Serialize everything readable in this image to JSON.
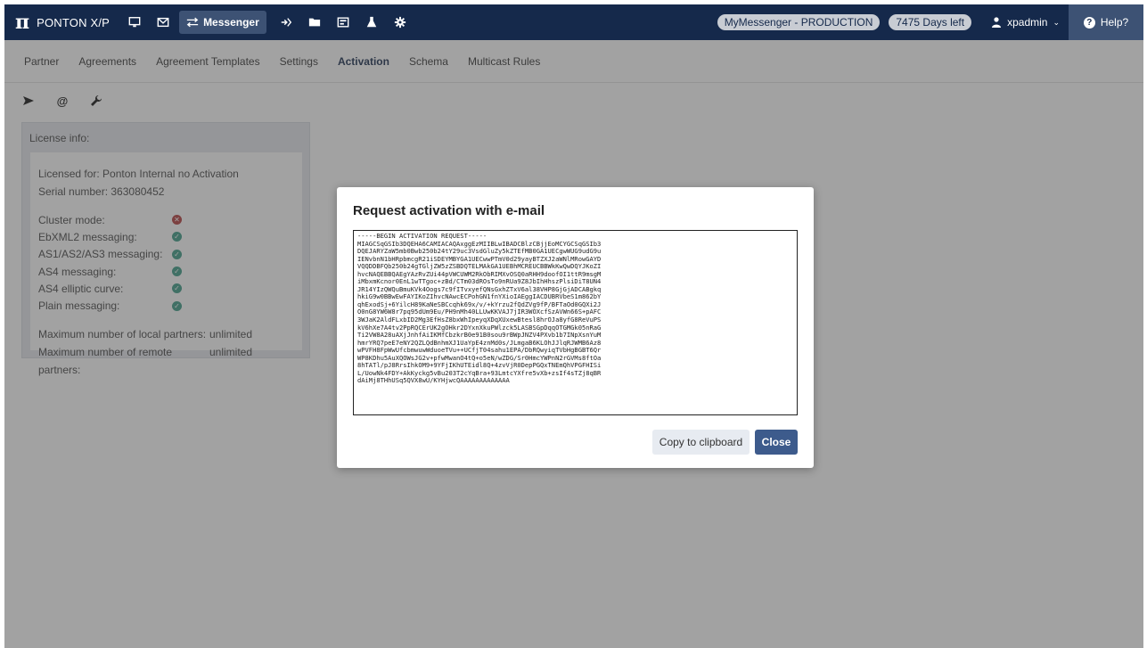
{
  "app": {
    "logo_glyph": "π",
    "name": "PONTON X/P"
  },
  "topnav": {
    "icons": [
      "monitor-icon",
      "mail-icon",
      "route-icon",
      "folder-icon",
      "card-icon",
      "flask-icon",
      "gear-icon"
    ],
    "active_label": "Messenger",
    "environment": "MyMessenger - PRODUCTION",
    "license_days": "7475 Days left",
    "user": "xpadmin",
    "help": "Help?"
  },
  "subnav": {
    "tabs": [
      "Partner",
      "Agreements",
      "Agreement Templates",
      "Settings",
      "Activation",
      "Schema",
      "Multicast Rules"
    ],
    "active": "Activation"
  },
  "toolbar": {
    "at_glyph": "@"
  },
  "license": {
    "heading": "License info:",
    "licensed_for": "Licensed for: Ponton Internal no Activation",
    "serial": "Serial number: 363080452",
    "features": [
      {
        "label": "Cluster mode:",
        "status": "no"
      },
      {
        "label": "EbXML2 messaging:",
        "status": "ok"
      },
      {
        "label": "AS1/AS2/AS3 messaging:",
        "status": "ok"
      },
      {
        "label": "AS4 messaging:",
        "status": "ok"
      },
      {
        "label": "AS4 elliptic curve:",
        "status": "ok"
      },
      {
        "label": "Plain messaging:",
        "status": "ok"
      }
    ],
    "partners": [
      {
        "label": "Maximum number of local partners:",
        "value": "unlimited"
      },
      {
        "label": "Maximum number of remote partners:",
        "value": "unlimited"
      }
    ]
  },
  "modal": {
    "title": "Request activation with e-mail",
    "request_text": "-----BEGIN ACTIVATION REQUEST-----\nMIAGCSqGSIb3DQEHA6CAMIACAQAxggEzMIIBLwIBADCBlzCBjjEoMCYGCSqGSIb3\nDQEJARYZaW5mb0Bwb250b24tY29uc3VsdGluZy5kZTEfMB0GA1UECgwWUG9udG9u\nIENvbnN1bHRpbmcgR21iSDEYMBYGA1UECwwPTmV0d29yayBTZXJ2aWNlMRowGAYD\nVQQDDBFQb250b24gTGljZW5zZSBDQTELMAkGA1UEBhMCREUCBBWkKwQwDQYJKoZI\nhvcNAQEBBQAEgYAzRvZUi44pVWCUWM2RkObRIMXvOSQ0aRHH9doofOI1ttR9msgM\niMbxmKcnor0EnL1wTTgoc+zBd/CTm03dROsTo9nRUa9Z8JbIhHhszPlsiDiT8UN4\nJR14YIzQWQuBmuKVk4Oogs7c9fITvxyefQNsGxhZTxV6al38VHP8GjGjADCABgkq\nhkiG9w0BBwEwFAYIKoZIhvcNAwcECPohGN1fnYXioIAEggIACDUBRVbeS1m862bY\nqhExodSj+6YilcH89KaNeSBCcqhk69x/v/+kYrzu2fQdZVg9fP/BFTaOd0GQXi2J\nO0nG8YW6W8r7pq95dUm9Eu/PH9nMh40LLUwKKVAJ7jIR3WOXcfSzAVWn66S+pAFC\n3WJaK2AldFLxbID2Mg3EfHsZ8bxWhIpeyqXDqXUxewBtesl8hrOJa8yfG8ReVuPS\nkV6hXe7A4tv2PpRQCErUK2gOHkr2DYxnXkuPWlzck5LASBSGpDqqOTGMGk05nRaG\nTi2VW8A28uAXjJnhfAiIKMfCbzkrB0e91B0sou9rBWpJNZV4PXvb1b7INpXsnYuM\nhmrYRQ7peE7eNY2QZLQdBnhmXJ1UaYpE4znMd0s/JLmgaB6KLOhJJlqRJWMB6Az8\nwPVFH8FpWwUfcbmwuwWduoeTVu++UCfjT04sahu1EPA/DbRQwyiqTVbHgBGBT6Qr\nWP8KDhu5AuXQOWsJG2v+pfwMwanO4tQ+o5eN/wZDG/Sr0HmcYWPnN2rGVMs8ftOa\n8hTATl/pJ8RrsIhkOM9+9YFjIKhUTEidl8Q+4zvVjR0DepPGQxTNEmQhVPGFHISi\nL/UowNk4FDY+AkKyckg5vBu203T2cYqBra+93LmtcYXfre5vXb+zsIf4sTZj8qBR\ndAiMj8THhUSq5QVX8wU/KYHjwcQAAAAAAAAAAAAA",
    "copy_label": "Copy to clipboard",
    "close_label": "Close"
  }
}
